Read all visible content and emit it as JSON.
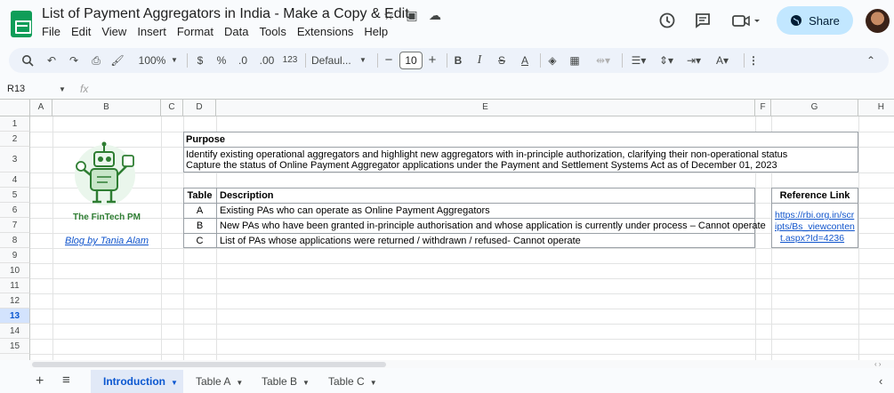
{
  "doc": {
    "title": "List of Payment Aggregators in India - Make a Copy & Edit",
    "menus": [
      "File",
      "Edit",
      "View",
      "Insert",
      "Format",
      "Data",
      "Tools",
      "Extensions",
      "Help"
    ],
    "share_label": "Share"
  },
  "toolbar": {
    "zoom": "100%",
    "currency": "$",
    "percent": "%",
    "dec_decrease": ".0",
    "dec_increase": ".00",
    "number_format": "123",
    "font": "Defaul...",
    "font_size": "10"
  },
  "formula": {
    "name_box": "R13",
    "fx": "fx"
  },
  "columns": [
    "A",
    "B",
    "C",
    "D",
    "E",
    "F",
    "G",
    "H"
  ],
  "rows": [
    "1",
    "2",
    "3",
    "4",
    "5",
    "6",
    "7",
    "8",
    "9",
    "10",
    "11",
    "12",
    "13",
    "14",
    "15"
  ],
  "selected_row": "13",
  "logo": {
    "name": "The FinTech PM",
    "blog_link": "Blog by Tania Alam"
  },
  "purpose": {
    "header": "Purpose",
    "line1": "Identify existing operational aggregators and highlight new aggregators with in-principle authorization, clarifying their non-operational status",
    "line2": "Capture the status of Online Payment Aggregator applications under the Payment and Settlement Systems Act as of December 01, 2023"
  },
  "table": {
    "col_table": "Table",
    "col_description": "Description",
    "rows": [
      {
        "id": "A",
        "desc": "Existing PAs who can operate as Online Payment Aggregators"
      },
      {
        "id": "B",
        "desc": "New PAs who have been granted in-principle authorisation and whose application is currently under process – Cannot operate"
      },
      {
        "id": "C",
        "desc": "List of PAs whose applications were returned / withdrawn / refused- Cannot operate"
      }
    ]
  },
  "reference": {
    "header": "Reference Link",
    "line1": "https://rbi.org.in/scr",
    "line2": "ipts/Bs_viewconten",
    "line3": "t.aspx?Id=4236"
  },
  "sheets": [
    {
      "label": "Introduction",
      "active": true
    },
    {
      "label": "Table A",
      "active": false
    },
    {
      "label": "Table B",
      "active": false
    },
    {
      "label": "Table C",
      "active": false
    }
  ],
  "colors": {
    "accent": "#0b57d0",
    "brand_green": "#0f9d58",
    "share_bg": "#c2e7ff"
  }
}
